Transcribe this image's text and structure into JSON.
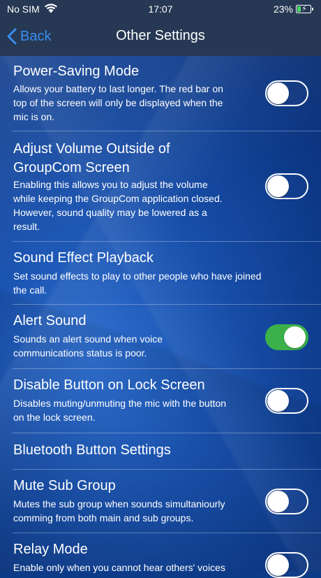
{
  "status_bar": {
    "carrier": "No SIM",
    "time": "17:07",
    "battery_percent": "23%"
  },
  "nav": {
    "back_label": "Back",
    "title": "Other Settings"
  },
  "settings": [
    {
      "title": "Power-Saving Mode",
      "description": [
        "Allows your battery to last longer. The red bar on",
        "top of the screen will only be displayed when the",
        "mic is on."
      ],
      "toggle": "off"
    },
    {
      "title_lines": [
        "Adjust Volume Outside of",
        "GroupCom Screen"
      ],
      "description": [
        "Enabling this allows you to adjust the volume",
        "while keeping the GroupCom application closed.",
        "However, sound quality may be lowered as a",
        "result."
      ],
      "toggle": "off"
    },
    {
      "title": "Sound Effect Playback",
      "description": [
        "Set sound effects to play to other people who have joined",
        "the call."
      ]
    },
    {
      "title": "Alert Sound",
      "description": [
        "Sounds an alert sound when voice",
        "communications status is poor."
      ],
      "toggle": "on"
    },
    {
      "title": "Disable Button on Lock Screen",
      "description": [
        "Disables muting/unmuting the mic with the button",
        "on the lock screen."
      ],
      "toggle": "off"
    },
    {
      "title": "Bluetooth Button Settings"
    },
    {
      "title": "Mute Sub Group",
      "description": [
        "Mutes the sub group when sounds simultaniourly",
        "comming from both main and sub groups."
      ],
      "toggle": "off"
    },
    {
      "title": "Relay Mode",
      "description": [
        "Enable only when you cannot hear others' voices"
      ],
      "toggle": "off"
    }
  ],
  "colors": {
    "header": "#263853",
    "accent_link": "#3a8ff0",
    "toggle_on": "#3cb14a"
  }
}
